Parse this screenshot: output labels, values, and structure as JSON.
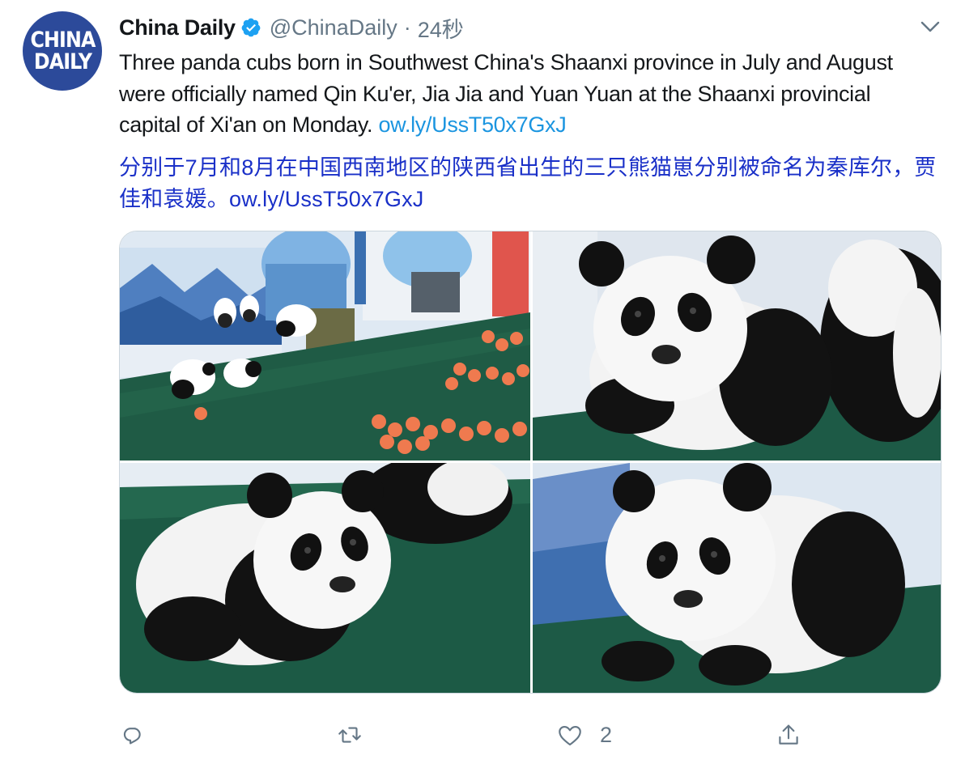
{
  "tweet": {
    "avatar": {
      "line1": "CHINA",
      "line2": "DAILY",
      "color": "#2c4a9a"
    },
    "display_name": "China Daily",
    "verified_icon": "verified-badge-icon",
    "handle": "@ChinaDaily",
    "separator": "·",
    "time": "24秒",
    "menu_icon": "chevron-down-icon",
    "text": "Three panda cubs born in Southwest China's Shaanxi province in July and August were officially named Qin Ku'er, Jia Jia and Yuan Yuan at the Shaanxi provincial capital of Xi'an on Monday. ",
    "link": "ow.ly/UssT50x7GxJ",
    "translation_text": "分别于7月和8月在中国西南地区的陕西省出生的三只熊猫崽分别被命名为秦库尔，贾佳和袁媛。",
    "translation_link": "ow.ly/UssT50x7GxJ",
    "media_count": 4,
    "actions": {
      "reply_icon": "reply-icon",
      "retweet_icon": "retweet-icon",
      "like_icon": "heart-icon",
      "like_count": "2",
      "share_icon": "share-icon"
    },
    "colors": {
      "link": "#1b95e0",
      "translation": "#1a30c8",
      "muted": "#657786",
      "verified": "#1da1f2"
    }
  }
}
